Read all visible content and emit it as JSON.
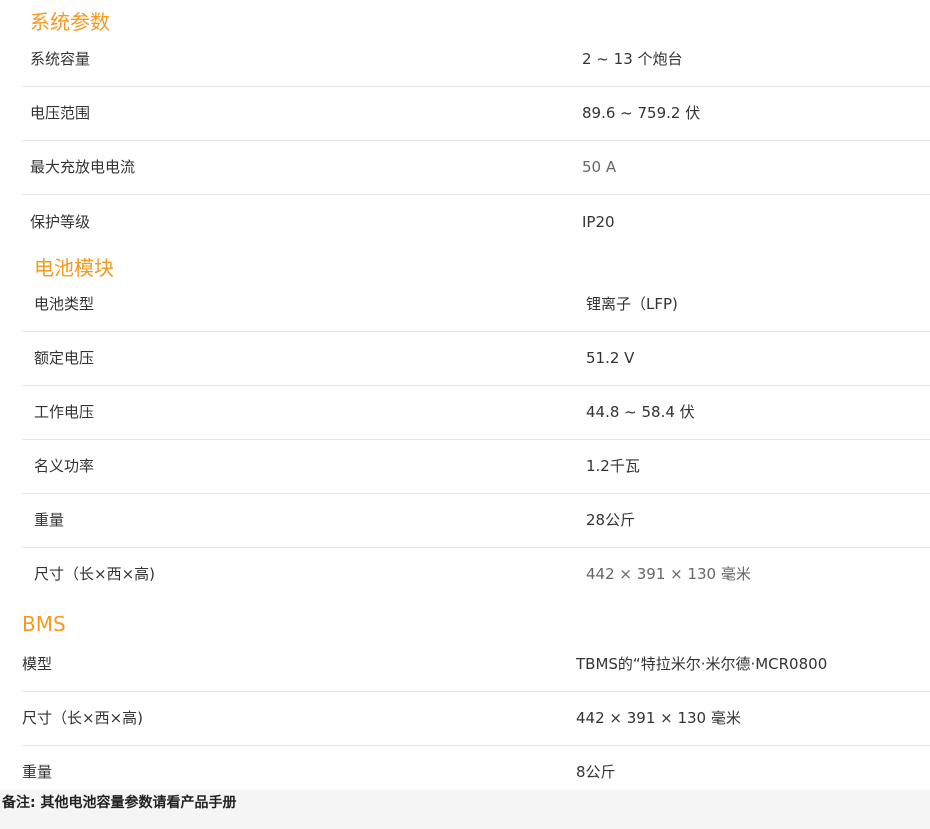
{
  "sections": [
    {
      "title": "系统参数",
      "rows": [
        {
          "label": "系统容量",
          "value": "2 ~ 13 个炮台"
        },
        {
          "label": "电压范围",
          "value": "89.6 ~ 759.2 伏"
        },
        {
          "label": "最大充放电电流",
          "value": "50 A"
        },
        {
          "label": "保护等级",
          "value": "IP20"
        }
      ]
    },
    {
      "title": "电池模块",
      "rows": [
        {
          "label": "电池类型",
          "value": "锂离子（LFP)"
        },
        {
          "label": "额定电压",
          "value": "51.2 V"
        },
        {
          "label": "工作电压",
          "value": "44.8 ~ 58.4 伏"
        },
        {
          "label": "名义功率",
          "value": "1.2千瓦"
        },
        {
          "label": "重量",
          "value": "28公斤"
        },
        {
          "label": "尺寸（长×西×高)",
          "value": "442 × 391 × 130 毫米"
        }
      ]
    },
    {
      "title": "BMS",
      "rows": [
        {
          "label": "模型",
          "value": "TBMS的“特拉米尔·米尔德·MCR0800"
        },
        {
          "label": "尺寸（长×西×高)",
          "value": "442 × 391 × 130 毫米"
        },
        {
          "label": "重量",
          "value": "8公斤"
        }
      ]
    }
  ],
  "footer": {
    "note": "备注: 其他电池容量参数请看产品手册"
  },
  "colors": {
    "section_title": "#f39a1f",
    "text": "#333333",
    "divider": "#e6e6e6",
    "footer_bg": "#f5f5f5"
  }
}
